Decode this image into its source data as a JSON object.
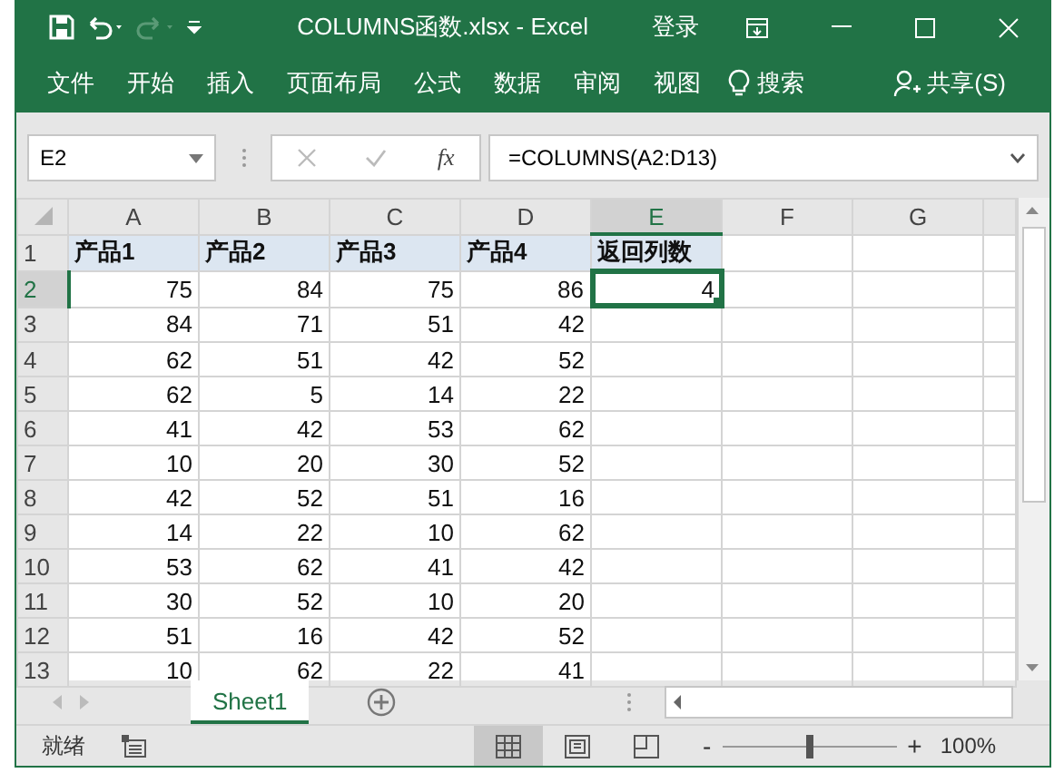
{
  "title_bar": {
    "title": "COLUMNS函数.xlsx  -  Excel",
    "sign_in": "登录"
  },
  "ribbon_tabs": [
    {
      "label": "文件"
    },
    {
      "label": "开始"
    },
    {
      "label": "插入"
    },
    {
      "label": "页面布局"
    },
    {
      "label": "公式"
    },
    {
      "label": "数据"
    },
    {
      "label": "审阅"
    },
    {
      "label": "视图"
    }
  ],
  "search": {
    "label": "搜索"
  },
  "share": {
    "label": "共享(S)"
  },
  "formula_bar": {
    "name_box": "E2",
    "fx": "fx",
    "formula": "=COLUMNS(A2:D13)"
  },
  "columns": [
    {
      "label": "A",
      "selected": false
    },
    {
      "label": "B",
      "selected": false
    },
    {
      "label": "C",
      "selected": false
    },
    {
      "label": "D",
      "selected": false
    },
    {
      "label": "E",
      "selected": true
    },
    {
      "label": "F",
      "selected": false
    },
    {
      "label": "G",
      "selected": false
    }
  ],
  "rows": [
    {
      "label": "1",
      "kind": "header",
      "selected": false,
      "cells": [
        {
          "value": "产品1",
          "selected": false
        },
        {
          "value": "产品2",
          "selected": false
        },
        {
          "value": "产品3",
          "selected": false
        },
        {
          "value": "产品4",
          "selected": false
        },
        {
          "value": "返回列数",
          "selected": false
        }
      ]
    },
    {
      "label": "2",
      "kind": "data",
      "selected": true,
      "cells": [
        {
          "value": "75",
          "selected": false
        },
        {
          "value": "84",
          "selected": false
        },
        {
          "value": "75",
          "selected": false
        },
        {
          "value": "86",
          "selected": false
        },
        {
          "value": "4",
          "selected": true
        }
      ]
    },
    {
      "label": "3",
      "kind": "data",
      "selected": false,
      "cells": [
        {
          "value": "84",
          "selected": false
        },
        {
          "value": "71",
          "selected": false
        },
        {
          "value": "51",
          "selected": false
        },
        {
          "value": "42",
          "selected": false
        }
      ]
    },
    {
      "label": "4",
      "kind": "data",
      "selected": false,
      "cells": [
        {
          "value": "62",
          "selected": false
        },
        {
          "value": "51",
          "selected": false
        },
        {
          "value": "42",
          "selected": false
        },
        {
          "value": "52",
          "selected": false
        }
      ]
    },
    {
      "label": "5",
      "kind": "data",
      "selected": false,
      "cells": [
        {
          "value": "62",
          "selected": false
        },
        {
          "value": "5",
          "selected": false
        },
        {
          "value": "14",
          "selected": false
        },
        {
          "value": "22",
          "selected": false
        }
      ]
    },
    {
      "label": "6",
      "kind": "data",
      "selected": false,
      "cells": [
        {
          "value": "41",
          "selected": false
        },
        {
          "value": "42",
          "selected": false
        },
        {
          "value": "53",
          "selected": false
        },
        {
          "value": "62",
          "selected": false
        }
      ]
    },
    {
      "label": "7",
      "kind": "data",
      "selected": false,
      "cells": [
        {
          "value": "10",
          "selected": false
        },
        {
          "value": "20",
          "selected": false
        },
        {
          "value": "30",
          "selected": false
        },
        {
          "value": "52",
          "selected": false
        }
      ]
    },
    {
      "label": "8",
      "kind": "data",
      "selected": false,
      "cells": [
        {
          "value": "42",
          "selected": false
        },
        {
          "value": "52",
          "selected": false
        },
        {
          "value": "51",
          "selected": false
        },
        {
          "value": "16",
          "selected": false
        }
      ]
    },
    {
      "label": "9",
      "kind": "data",
      "selected": false,
      "cells": [
        {
          "value": "14",
          "selected": false
        },
        {
          "value": "22",
          "selected": false
        },
        {
          "value": "10",
          "selected": false
        },
        {
          "value": "62",
          "selected": false
        }
      ]
    },
    {
      "label": "10",
      "kind": "data",
      "selected": false,
      "cells": [
        {
          "value": "53",
          "selected": false
        },
        {
          "value": "62",
          "selected": false
        },
        {
          "value": "41",
          "selected": false
        },
        {
          "value": "42",
          "selected": false
        }
      ]
    },
    {
      "label": "11",
      "kind": "data",
      "selected": false,
      "cells": [
        {
          "value": "30",
          "selected": false
        },
        {
          "value": "52",
          "selected": false
        },
        {
          "value": "10",
          "selected": false
        },
        {
          "value": "20",
          "selected": false
        }
      ]
    },
    {
      "label": "12",
      "kind": "data",
      "selected": false,
      "cells": [
        {
          "value": "51",
          "selected": false
        },
        {
          "value": "16",
          "selected": false
        },
        {
          "value": "42",
          "selected": false
        },
        {
          "value": "52",
          "selected": false
        }
      ]
    },
    {
      "label": "13",
      "kind": "data",
      "selected": false,
      "cells": [
        {
          "value": "10",
          "selected": false
        },
        {
          "value": "62",
          "selected": false
        },
        {
          "value": "22",
          "selected": false
        },
        {
          "value": "41",
          "selected": false
        }
      ]
    }
  ],
  "sheet_tabs": [
    {
      "label": "Sheet1",
      "selected": true
    }
  ],
  "status_bar": {
    "status": "就绪",
    "views": [
      {
        "kind": "normal",
        "selected": true
      },
      {
        "kind": "page_layout",
        "selected": false
      },
      {
        "kind": "page_break",
        "selected": false
      }
    ],
    "zoom_minus": "-",
    "zoom_plus": "+",
    "zoom": {
      "level": 0.5
    },
    "zoom_percent": "100%"
  }
}
